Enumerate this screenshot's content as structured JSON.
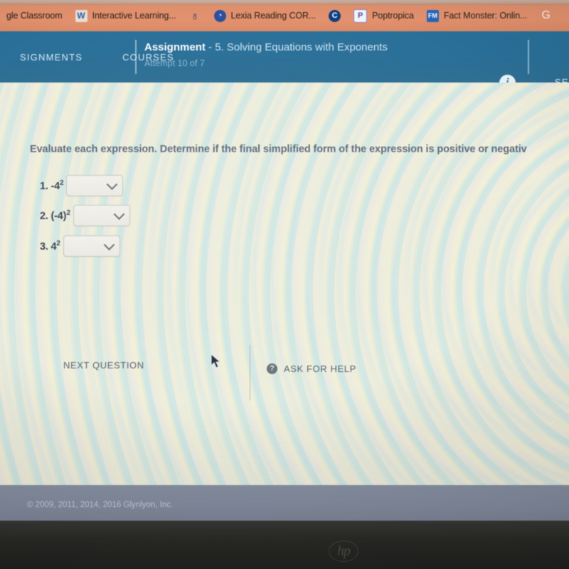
{
  "browser": {
    "bookmarks": [
      {
        "label": "gle Classroom",
        "icon": "",
        "icon_name": "none-icon",
        "icon_class": ""
      },
      {
        "label": "Interactive Learning...",
        "icon": "W",
        "icon_name": "w-wixie-icon",
        "icon_class": "ico-w"
      },
      {
        "label": "",
        "icon": "♁",
        "icon_name": "globe-icon",
        "icon_class": "ico-globe"
      },
      {
        "label": "Lexia Reading COR...",
        "icon": "◔",
        "icon_name": "lexia-icon",
        "icon_class": "ico-lexia"
      },
      {
        "label": "",
        "icon": "C",
        "icon_name": "clever-icon",
        "icon_class": "ico-c"
      },
      {
        "label": "Poptropica",
        "icon": "P",
        "icon_name": "poptropica-icon",
        "icon_class": "ico-p"
      },
      {
        "label": "Fact Monster: Onlin...",
        "icon": "FM",
        "icon_name": "fact-monster-icon",
        "icon_class": "ico-fm"
      },
      {
        "label": "",
        "icon": "G",
        "icon_name": "google-icon",
        "icon_class": "ico-g"
      }
    ]
  },
  "header": {
    "nav": [
      {
        "label": "SIGNMENTS"
      },
      {
        "label": "COURSES"
      }
    ],
    "title_strong": "Assignment",
    "title_rest": " - 5. Solving Equations with Exponents",
    "subtitle": "Attempt 10 of 7",
    "info_icon_glyph": "i",
    "right_label": "SEC"
  },
  "main": {
    "prompt": "Evaluate each expression. Determine if the final simplified form of the expression is positive or negativ",
    "questions": [
      {
        "number": "1.",
        "base": "-4",
        "exponent": "2",
        "paren": false,
        "answer": "",
        "dropdown_value": ""
      },
      {
        "number": "2.",
        "base": "(-4)",
        "exponent": "2",
        "paren": true,
        "answer": "",
        "dropdown_value": ""
      },
      {
        "number": "3.",
        "base": "4",
        "exponent": "2",
        "paren": false,
        "answer": "",
        "dropdown_value": ""
      }
    ],
    "next_question_label": "NEXT QUESTION",
    "ask_for_help_label": "ASK FOR HELP",
    "help_icon_glyph": "?"
  },
  "footer": {
    "copyright": "© 2009, 2011, 2014, 2016 Glynlyon, Inc."
  },
  "device": {
    "brand_logo": "hp"
  },
  "colors": {
    "bookmark_bar": "#e0906d",
    "app_header": "#2b7099",
    "page_background": "#ebeae2",
    "footer_bar": "#858ea1",
    "bezel": "#2a2a27",
    "prompt_text": "#5d6b7a",
    "button_text": "#5a6470"
  }
}
